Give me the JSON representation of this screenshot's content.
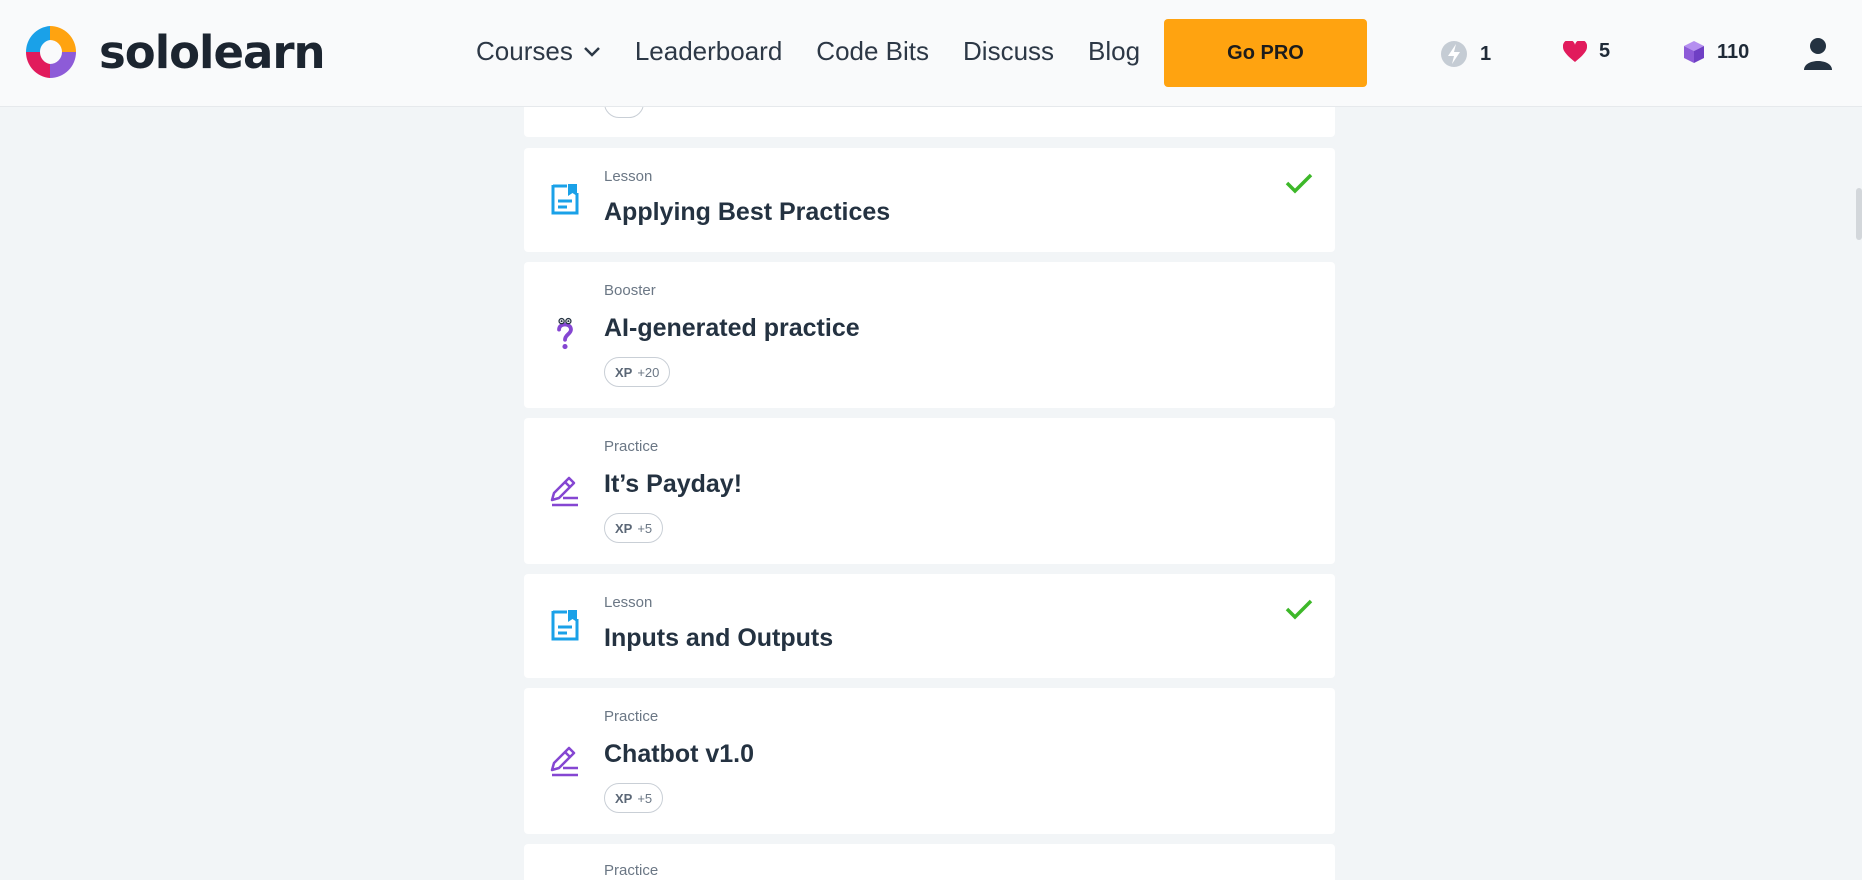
{
  "brand": {
    "name": "sololearn"
  },
  "nav": {
    "courses": "Courses",
    "leaderboard": "Leaderboard",
    "code_bits": "Code Bits",
    "discuss": "Discuss",
    "blog": "Blog"
  },
  "gopro_label": "Go PRO",
  "stats": {
    "streak": "1",
    "hearts": "5",
    "gems": "110"
  },
  "colors": {
    "accent": "#ffa310",
    "heart": "#e11b5c",
    "gem": "#8d5bd8",
    "lesson_icon": "#1aa1e8",
    "practice_icon": "#8546d2",
    "check": "#3db829"
  },
  "cards": [
    {
      "kind": "Lesson",
      "title": "Applying Best Practices",
      "completed": true,
      "icon": "lesson-icon"
    },
    {
      "kind": "Booster",
      "title": "AI-generated practice",
      "xp_label": "XP",
      "xp_value": "+20",
      "icon": "question-booster-icon"
    },
    {
      "kind": "Practice",
      "title": "It’s Payday!",
      "xp_label": "XP",
      "xp_value": "+5",
      "icon": "pencil-icon"
    },
    {
      "kind": "Lesson",
      "title": "Inputs and Outputs",
      "completed": true,
      "icon": "lesson-icon"
    },
    {
      "kind": "Practice",
      "title": "Chatbot v1.0",
      "xp_label": "XP",
      "xp_value": "+5",
      "icon": "pencil-icon"
    },
    {
      "kind": "Practice",
      "icon": "pencil-icon"
    }
  ]
}
